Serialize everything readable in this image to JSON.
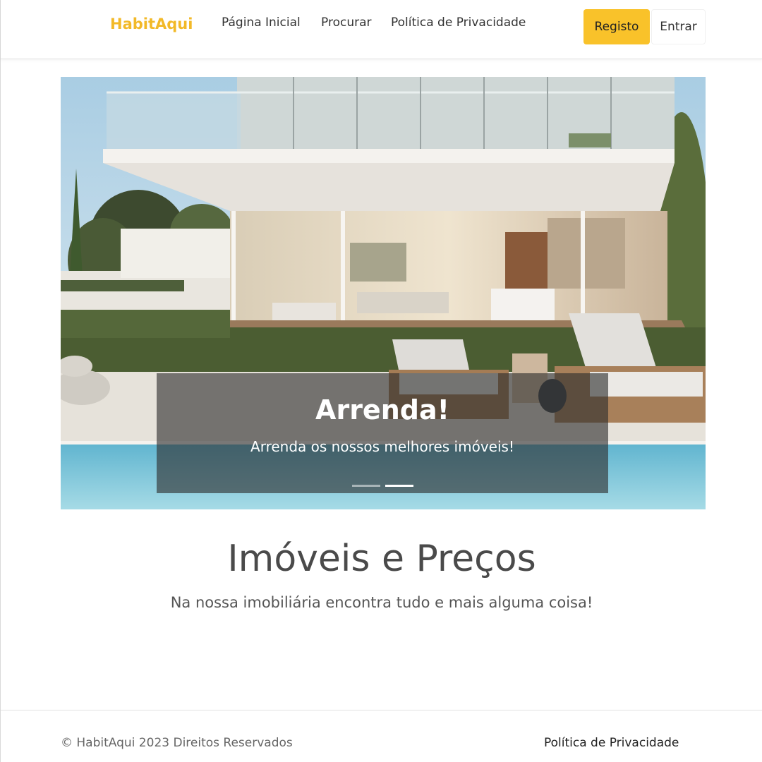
{
  "header": {
    "brand": "HabitAqui",
    "nav": {
      "home": "Página Inicial",
      "search": "Procurar",
      "privacy": "Política de Privacidade"
    },
    "register_label": "Registo",
    "login_label": "Entrar"
  },
  "hero": {
    "title": "Arrenda!",
    "text": "Arrenda os nossos melhores imóveis!",
    "active_slide": 2,
    "slide_count": 2
  },
  "intro": {
    "title": "Imóveis e Preços",
    "subtitle": "Na nossa imobiliária encontra tudo e mais alguma coisa!"
  },
  "footer": {
    "copyright": "© HabitAqui 2023 Direitos Reservados",
    "privacy_link": "Política de Privacidade"
  },
  "colors": {
    "brand": "#f2b928",
    "register_button": "#f9c22a"
  }
}
